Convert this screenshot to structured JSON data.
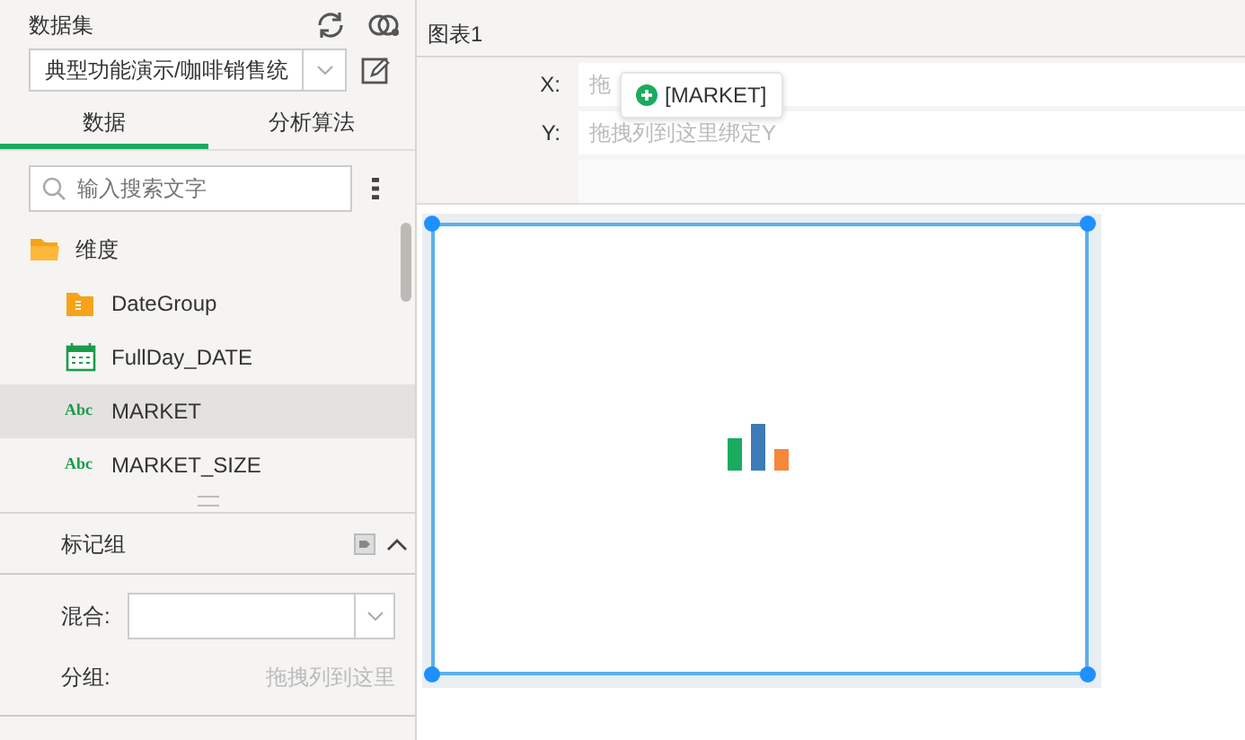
{
  "dataset": {
    "title": "数据集",
    "selected_value": "典型功能演示/咖啡销售统"
  },
  "tabs": [
    {
      "label": "数据",
      "selected": true
    },
    {
      "label": "分析算法",
      "selected": false
    }
  ],
  "search": {
    "placeholder": "输入搜索文字"
  },
  "tree": [
    {
      "label": "维度",
      "kind": "folder",
      "children": [
        {
          "label": "DateGroup",
          "kind": "group",
          "selected": false
        },
        {
          "label": "FullDay_DATE",
          "kind": "date",
          "selected": false
        },
        {
          "label": "MARKET",
          "kind": "text",
          "type_badge": "Abc",
          "selected": true
        },
        {
          "label": "MARKET_SIZE",
          "kind": "text",
          "type_badge": "Abc",
          "selected": false
        }
      ]
    }
  ],
  "mark_group": {
    "title": "标记组",
    "expanded": true,
    "mix_label": "混合:",
    "group_label": "分组:",
    "group_placeholder": "拖拽列到这里"
  },
  "chart": {
    "title": "图表1",
    "bindings": [
      {
        "label": "X:",
        "placeholder": "拖"
      },
      {
        "label": "Y:",
        "placeholder": "拖拽列到这里绑定Y"
      }
    ],
    "drag_tooltip": "[MARKET]",
    "selected": true
  }
}
